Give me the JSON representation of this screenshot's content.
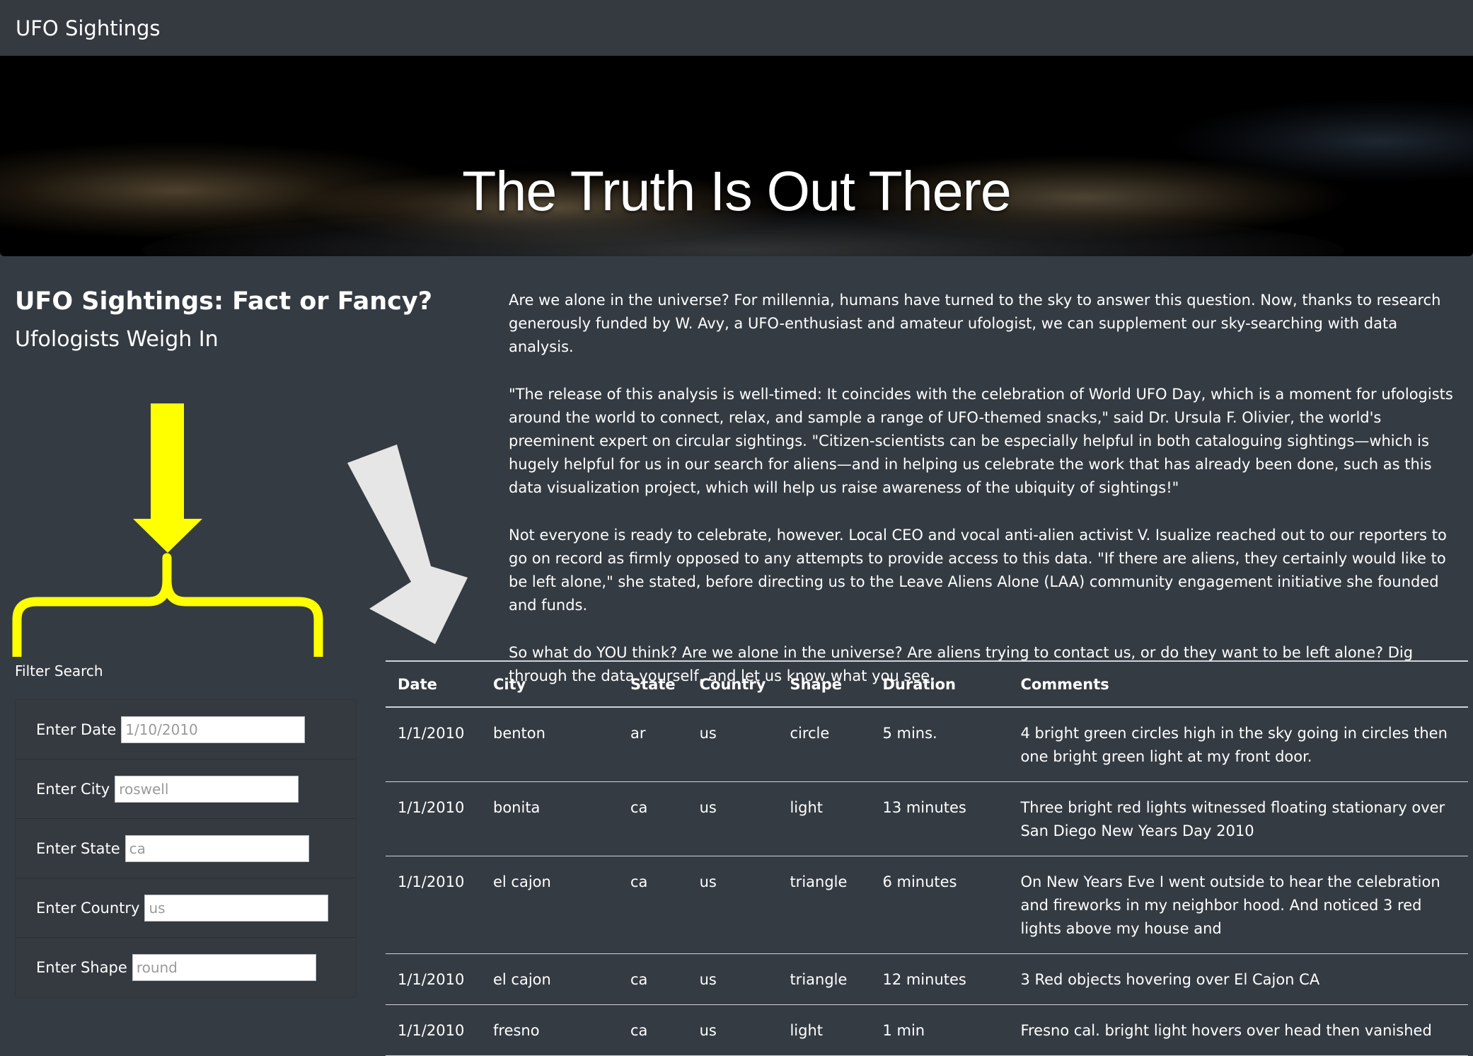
{
  "navbar": {
    "brand": "UFO Sightings"
  },
  "hero": {
    "title": "The Truth Is Out There"
  },
  "article": {
    "title": "UFO Sightings: Fact or Fancy?",
    "subtitle": "Ufologists Weigh In",
    "paragraphs": [
      "Are we alone in the universe? For millennia, humans have turned to the sky to answer this question. Now, thanks to research generously funded by W. Avy, a UFO-enthusiast and amateur ufologist, we can supplement our sky-searching with data analysis.",
      "\"The release of this analysis is well-timed: It coincides with the celebration of World UFO Day, which is a moment for ufologists around the world to connect, relax, and sample a range of UFO-themed snacks,\" said Dr. Ursula F. Olivier, the world's preeminent expert on circular sightings. \"Citizen-scientists can be especially helpful in both cataloguing sightings—which is hugely helpful for us in our search for aliens—and in helping us celebrate the work that has already been done, such as this data visualization project, which will help us raise awareness of the ubiquity of sightings!\"",
      "Not everyone is ready to celebrate, however. Local CEO and vocal anti-alien activist V. Isualize reached out to our reporters to go on record as firmly opposed to any attempts to provide access to this data. \"If there are aliens, they certainly would like to be left alone,\" she stated, before directing us to the Leave Aliens Alone (LAA) community engagement initiative she founded and funds.",
      "So what do YOU think? Are we alone in the universe? Are aliens trying to contact us, or do they want to be left alone? Dig through the data yourself, and let us know what you see."
    ]
  },
  "filters": {
    "heading": "Filter Search",
    "items": [
      {
        "label": "Enter Date",
        "placeholder": "1/10/2010"
      },
      {
        "label": "Enter City",
        "placeholder": "roswell"
      },
      {
        "label": "Enter State",
        "placeholder": "ca"
      },
      {
        "label": "Enter Country",
        "placeholder": "us"
      },
      {
        "label": "Enter Shape",
        "placeholder": "round"
      }
    ]
  },
  "table": {
    "headers": [
      "Date",
      "City",
      "State",
      "Country",
      "Shape",
      "Duration",
      "Comments"
    ],
    "rows": [
      [
        "1/1/2010",
        "benton",
        "ar",
        "us",
        "circle",
        "5 mins.",
        "4 bright green circles high in the sky going in circles then one bright green light at my front door."
      ],
      [
        "1/1/2010",
        "bonita",
        "ca",
        "us",
        "light",
        "13 minutes",
        "Three bright red lights witnessed floating stationary over San Diego New Years Day 2010"
      ],
      [
        "1/1/2010",
        "el cajon",
        "ca",
        "us",
        "triangle",
        "6 minutes",
        "On New Years Eve I went outside to hear the celebration and fireworks in my neighbor hood. And noticed 3 red lights above my house and"
      ],
      [
        "1/1/2010",
        "el cajon",
        "ca",
        "us",
        "triangle",
        "12 minutes",
        "3 Red objects hovering over El Cajon CA"
      ],
      [
        "1/1/2010",
        "fresno",
        "ca",
        "us",
        "light",
        "1 min",
        "Fresno cal. bright light hovers over head then vanished"
      ]
    ]
  },
  "colors": {
    "page_background": "#353b43",
    "navbar_background": "#343a40",
    "annotation_yellow": "#ffff00",
    "annotation_white": "#e6e6e6"
  }
}
